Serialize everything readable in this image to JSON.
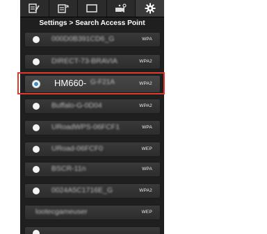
{
  "toolbar": {
    "tabs": [
      {
        "icon": "notes-icon"
      },
      {
        "icon": "list-export-icon"
      },
      {
        "icon": "window-icon"
      },
      {
        "icon": "camera-settings-icon"
      },
      {
        "icon": "gear-icon"
      }
    ]
  },
  "header": {
    "title": "Settings > Search Access Point"
  },
  "access_points": [
    {
      "ssid": "000D0B391CD6_G",
      "security": "WPA"
    },
    {
      "ssid": "DIRECT-73-BRAVIA",
      "security": "WPA2"
    },
    {
      "ssid_visible": "HM660-",
      "ssid_masked": "G-F21A",
      "security": "WPA2",
      "selected": true
    },
    {
      "ssid": "Buffalo-G-0D04",
      "security": "WPA2"
    },
    {
      "ssid": "URoadWPS-06FCF1",
      "security": "WPA"
    },
    {
      "ssid": "URoad-06FCF0",
      "security": "WEP"
    },
    {
      "ssid": "BSCR-11n",
      "security": "WPA"
    },
    {
      "ssid": "0024A5C1716E_G",
      "security": "WPA2"
    },
    {
      "ssid": "lootecgameuser",
      "security": "WEP"
    }
  ],
  "colors": {
    "highlight": "#e03a2f",
    "selected_radio": "#3c8ec9"
  }
}
